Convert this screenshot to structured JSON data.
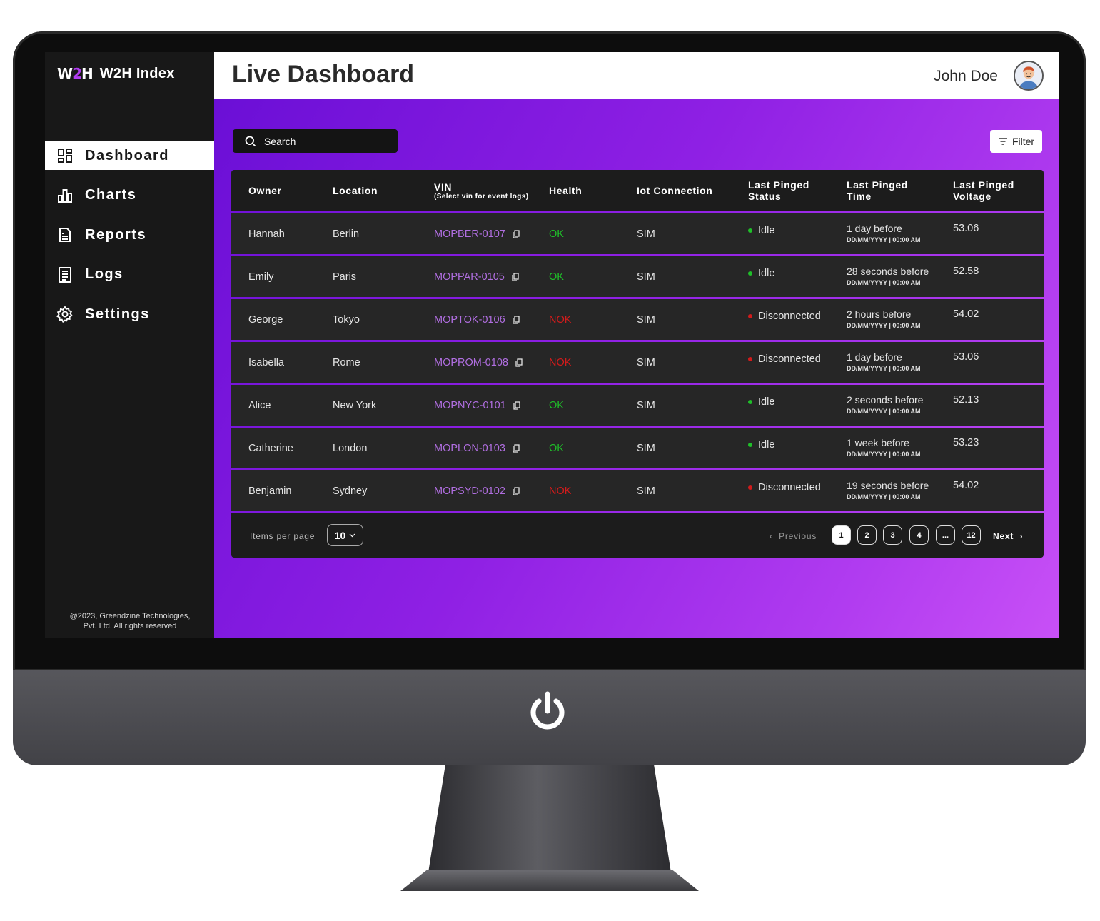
{
  "brand": {
    "logo_text_a": "W",
    "logo_text_b": "2",
    "logo_text_c": "H",
    "name": "W2H Index"
  },
  "sidebar": {
    "items": [
      {
        "label": "Dashboard",
        "icon": "dashboard-icon",
        "active": true
      },
      {
        "label": "Charts",
        "icon": "bar-chart-icon",
        "active": false
      },
      {
        "label": "Reports",
        "icon": "report-icon",
        "active": false
      },
      {
        "label": "Logs",
        "icon": "log-icon",
        "active": false
      },
      {
        "label": "Settings",
        "icon": "gear-icon",
        "active": false
      }
    ],
    "copyright_line1": "@2023, Greendzine Technologies,",
    "copyright_line2": "Pvt. Ltd. All rights reserved"
  },
  "header": {
    "title": "Live Dashboard",
    "user_name": "John Doe"
  },
  "toolbar": {
    "search_placeholder": "Search",
    "filter_label": "Filter"
  },
  "table": {
    "columns": {
      "owner": "Owner",
      "location": "Location",
      "vin": "VIN",
      "vin_hint": "(Select vin for event logs)",
      "health": "Health",
      "iot": "Iot Connection",
      "status_line1": "Last Pinged",
      "status_line2": "Status",
      "time_line1": "Last Pinged",
      "time_line2": "Time",
      "voltage_line1": "Last Pinged",
      "voltage_line2": "Voltage"
    },
    "rows": [
      {
        "owner": "Hannah",
        "location": "Berlin",
        "vin": "MOPBER-0107",
        "health": "OK",
        "iot": "SIM",
        "status": "Idle",
        "time": "1 day before",
        "time_abs": "DD/MM/YYYY | 00:00 AM",
        "voltage": "53.06"
      },
      {
        "owner": "Emily",
        "location": "Paris",
        "vin": "MOPPAR-0105",
        "health": "OK",
        "iot": "SIM",
        "status": "Idle",
        "time": "28 seconds before",
        "time_abs": "DD/MM/YYYY | 00:00 AM",
        "voltage": "52.58"
      },
      {
        "owner": "George",
        "location": "Tokyo",
        "vin": "MOPTOK-0106",
        "health": "NOK",
        "iot": "SIM",
        "status": "Disconnected",
        "time": "2 hours before",
        "time_abs": "DD/MM/YYYY | 00:00 AM",
        "voltage": "54.02"
      },
      {
        "owner": "Isabella",
        "location": "Rome",
        "vin": "MOPROM-0108",
        "health": "NOK",
        "iot": "SIM",
        "status": "Disconnected",
        "time": "1 day before",
        "time_abs": "DD/MM/YYYY | 00:00 AM",
        "voltage": "53.06"
      },
      {
        "owner": "Alice",
        "location": "New York",
        "vin": "MOPNYC-0101",
        "health": "OK",
        "iot": "SIM",
        "status": "Idle",
        "time": "2 seconds before",
        "time_abs": "DD/MM/YYYY | 00:00 AM",
        "voltage": "52.13"
      },
      {
        "owner": "Catherine",
        "location": "London",
        "vin": "MOPLON-0103",
        "health": "OK",
        "iot": "SIM",
        "status": "Idle",
        "time": "1 week before",
        "time_abs": "DD/MM/YYYY | 00:00 AM",
        "voltage": "53.23"
      },
      {
        "owner": "Benjamin",
        "location": "Sydney",
        "vin": "MOPSYD-0102",
        "health": "NOK",
        "iot": "SIM",
        "status": "Disconnected",
        "time": "19 seconds before",
        "time_abs": "DD/MM/YYYY | 00:00 AM",
        "voltage": "54.02"
      }
    ]
  },
  "pagination": {
    "items_per_page_label": "Items per page",
    "items_per_page_value": "10",
    "previous_label": "Previous",
    "next_label": "Next",
    "pages": [
      "1",
      "2",
      "3",
      "4",
      "...",
      "12"
    ],
    "current_page": "1"
  },
  "colors": {
    "accent_purple": "#8f20e4",
    "ok_green": "#1fbf29",
    "nok_red": "#d21b1b",
    "vin_purple": "#b06ee0",
    "sidebar_bg": "#181818"
  }
}
